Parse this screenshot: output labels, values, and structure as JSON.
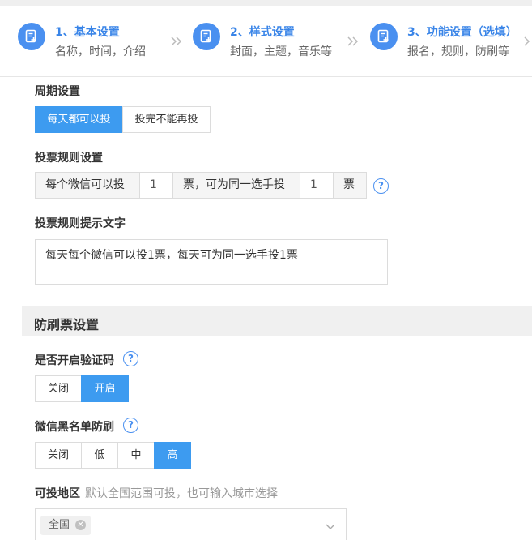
{
  "steps": [
    {
      "title": "1、基本设置",
      "sub": "名称，时间，介绍"
    },
    {
      "title": "2、样式设置",
      "sub": "封面，主题，音乐等"
    },
    {
      "title": "3、功能设置（选填）",
      "sub": "报名，规则，防刷等"
    }
  ],
  "cycle": {
    "label": "周期设置",
    "options": [
      "每天都可以投",
      "投完不能再投"
    ],
    "selected": "每天都可以投"
  },
  "vote_rule": {
    "label": "投票规则设置",
    "prefix": "每个微信可以投",
    "votes_value": "1",
    "middle": "票，可为同一选手投",
    "same_player_value": "1",
    "suffix": "票"
  },
  "rule_tip": {
    "label": "投票规则提示文字",
    "value": "每天每个微信可以投1票，每天可为同一选手投1票"
  },
  "anti_fraud": {
    "section_title": "防刷票设置",
    "captcha": {
      "label": "是否开启验证码",
      "options": [
        "关闭",
        "开启"
      ],
      "selected": "开启"
    },
    "blacklist": {
      "label": "微信黑名单防刷",
      "options": [
        "关闭",
        "低",
        "中",
        "高"
      ],
      "selected": "高"
    },
    "region": {
      "label": "可投地区",
      "hint": "默认全国范围可投，也可输入城市选择",
      "tags": [
        "全国"
      ]
    }
  },
  "colors": {
    "accent": "#3d9bf0",
    "step_title": "#3a85e8",
    "section_bg": "#f0f0f0"
  },
  "icons": {
    "step": "edit-document-icon",
    "separator": "double-chevron-right-icon",
    "help": "question-circle-icon",
    "tag_close": "close-circle-icon",
    "dropdown": "chevron-down-icon"
  }
}
